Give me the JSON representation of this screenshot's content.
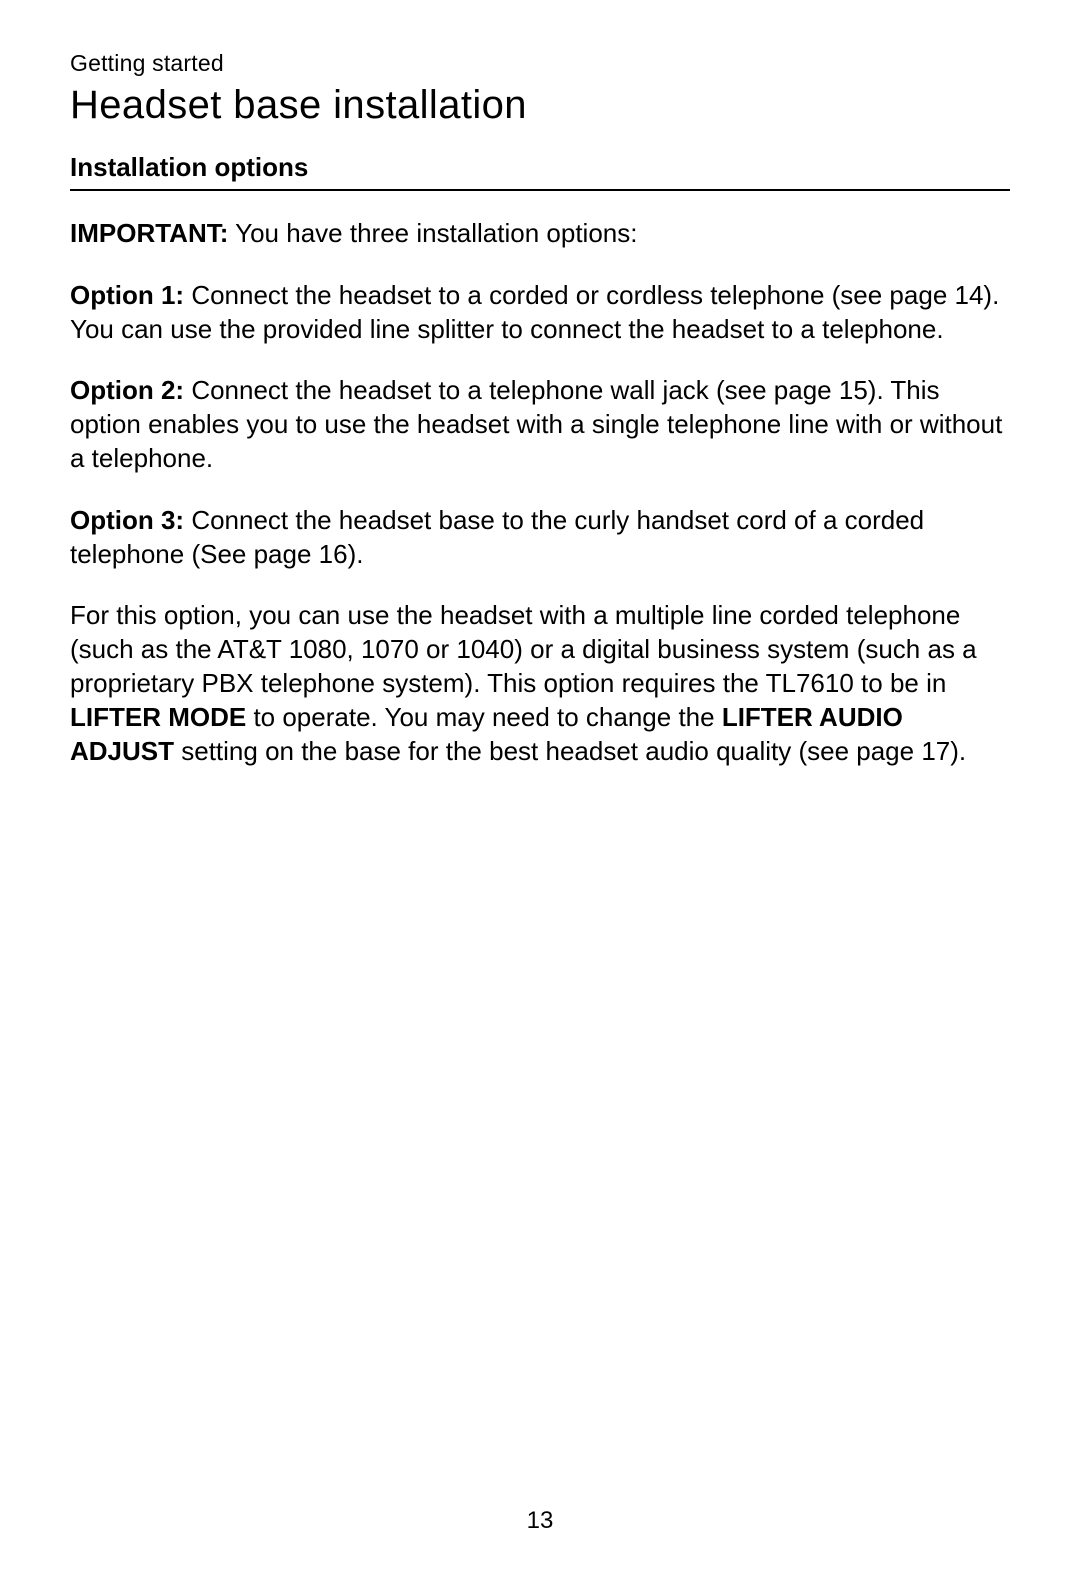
{
  "header": {
    "section": "Getting started",
    "title": "Headset base installation"
  },
  "subhead": "Installation options",
  "intro": {
    "label": "IMPORTANT:",
    "text": " You have three installation options:"
  },
  "option1": {
    "label": "Option 1:",
    "text": " Connect the headset to a corded or cordless telephone (see page 14). You can use the provided line splitter to connect the headset to a telephone."
  },
  "option2": {
    "label": "Option 2:",
    "text": " Connect the headset to a telephone wall jack (see page 15). This option enables you to use the headset with a single telephone line with or without a telephone."
  },
  "option3": {
    "label": "Option 3:",
    "text": " Connect the headset base to the curly handset cord of a corded telephone (See page 16)."
  },
  "footnote": {
    "pre": "For this option, you can use the headset with a multiple line corded telephone (such as the AT&T 1080, 1070 or 1040) or a digital business system (such as a proprietary PBX telephone system). This option requires the TL7610 to be in ",
    "bold1": "LIFTER MODE",
    "mid": " to operate. You may need to change the ",
    "bold2": "LIFTER AUDIO ADJUST",
    "post": " setting on the base for the best headset audio quality (see page 17)."
  },
  "pageNumber": "13"
}
